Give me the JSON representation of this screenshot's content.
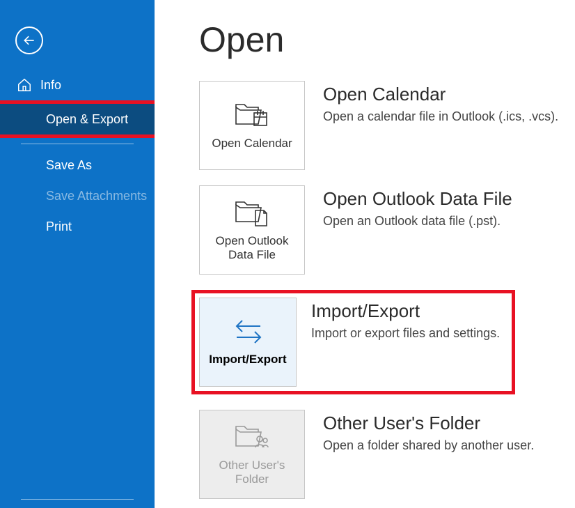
{
  "sidebar": {
    "items": [
      {
        "label": "Info"
      },
      {
        "label": "Open & Export"
      },
      {
        "label": "Save As"
      },
      {
        "label": "Save Attachments"
      },
      {
        "label": "Print"
      }
    ]
  },
  "main": {
    "title": "Open",
    "options": [
      {
        "tile_label": "Open Calendar",
        "heading": "Open Calendar",
        "desc": "Open a calendar file in Outlook (.ics, .vcs)."
      },
      {
        "tile_label": "Open Outlook Data File",
        "heading": "Open Outlook Data File",
        "desc": "Open an Outlook data file (.pst)."
      },
      {
        "tile_label": "Import/Export",
        "heading": "Import/Export",
        "desc": "Import or export files and settings."
      },
      {
        "tile_label": "Other User's Folder",
        "heading": "Other User's Folder",
        "desc": "Open a folder shared by another user."
      }
    ]
  }
}
